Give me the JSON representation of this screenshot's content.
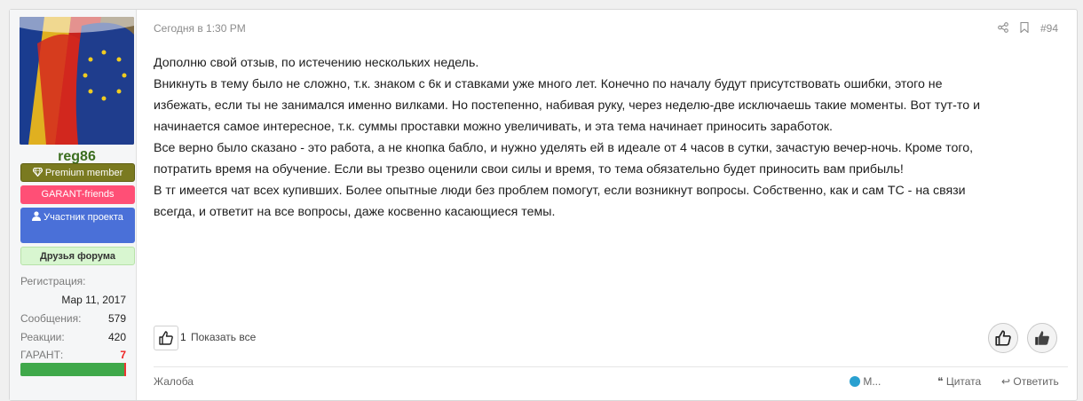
{
  "user": {
    "username": "reg86",
    "badges": {
      "premium": "Premium member",
      "garant": "GARANT-friends",
      "member": "Участник проекта",
      "friends": "Друзья форума"
    },
    "stats": {
      "registration_label": "Регистрация:",
      "registration_value": "Мар 11, 2017",
      "messages_label": "Сообщения:",
      "messages_value": "579",
      "reactions_label": "Реакции:",
      "reactions_value": "420",
      "garant_label": "ГАРАНТ:",
      "garant_value": "7"
    }
  },
  "post": {
    "time": "Сегодня в 1:30 PM",
    "number": "#94",
    "lines": [
      "Дополню свой отзыв, по истечению нескольких недель.",
      "Вникнуть в тему было не сложно, т.к. знаком с 6к и ставками уже много лет. Конечно по началу будут присутствовать ошибки, этого не",
      "избежать, если ты не занимался именно вилками. Но постепенно, набивая руку, через неделю-две исключаешь такие моменты. Вот тут-то и",
      "начинается самое интересное, т.к. суммы проставки можно увеличивать, и эта тема начинает приносить заработок.",
      "Все верно было сказано - это работа, а не кнопка бабло, и нужно уделять ей в идеале от 4 часов в сутки, зачастую вечер-ночь. Кроме того,",
      "потратить время на обучение. Если вы трезво оценили свои силы и время, то тема обязательно будет приносить вам прибыль!",
      "В тг имеется чат всех купивших. Более опытные люди без проблем помогут, если возникнут вопросы. Собственно, как и сам ТС - на связи",
      "всегда, и ответит на все вопросы, даже косвенно касающиеся темы."
    ],
    "likes_count": "1",
    "show_all": "Показать все"
  },
  "footer": {
    "complaint": "Жалоба",
    "multiquote": "М...",
    "quote": "Цитата",
    "reply": "Ответить"
  },
  "icons": [
    "share-icon",
    "bookmark-icon",
    "like-icon",
    "thumbs-up-icon",
    "gem-icon",
    "user-icon"
  ],
  "colors": {
    "username": "#3b6e1f",
    "premium": "#7a7a20",
    "garant": "#ff4f76",
    "member": "#4a70d8",
    "friends": "#d8f6d0",
    "garant_bar": "#3fa84a"
  }
}
